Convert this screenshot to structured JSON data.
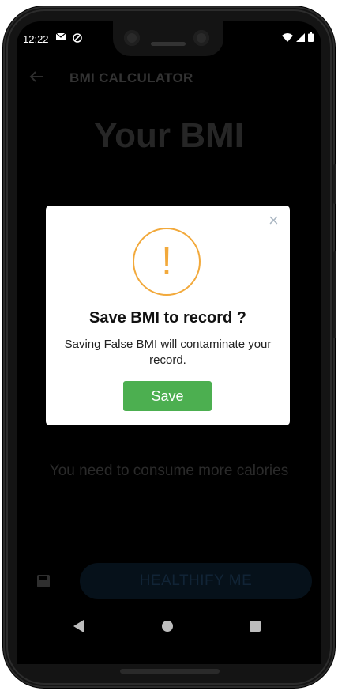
{
  "status_bar": {
    "time": "12:22",
    "left_icons": [
      "mail-icon",
      "sync-icon"
    ],
    "right_icons": [
      "wifi-icon",
      "signal-icon",
      "battery-icon"
    ]
  },
  "app_bar": {
    "title": "BMI CALCULATOR",
    "back_icon": "arrow-left-icon"
  },
  "main": {
    "heading": "Your BMI",
    "advice": "You need to consume more calories",
    "save_icon": "floppy-disk-icon",
    "primary_button_label": "HEALTHIFY ME"
  },
  "dialog": {
    "icon": "exclamation-icon",
    "icon_glyph": "!",
    "close_glyph": "×",
    "title": "Save BMI to record ?",
    "message": "Saving False BMI will contaminate your record.",
    "confirm_label": "Save"
  },
  "colors": {
    "accent_green": "#4caf50",
    "warning_orange": "#f2a93b",
    "overlay_background": "#000000"
  }
}
